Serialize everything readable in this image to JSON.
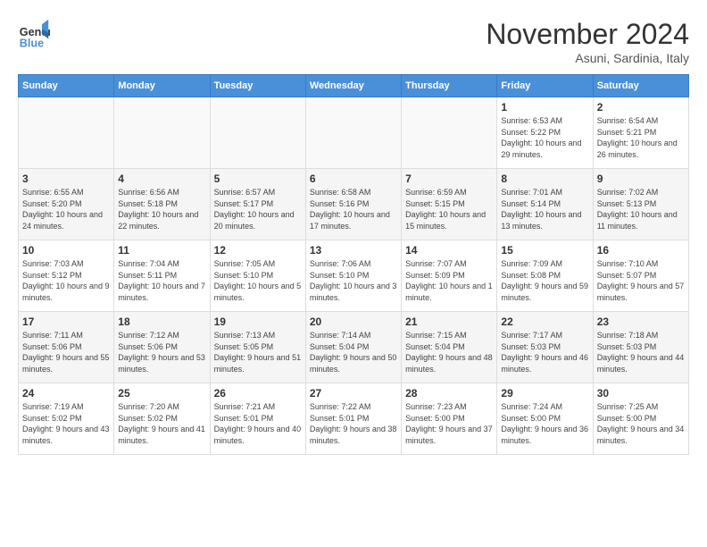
{
  "header": {
    "logo_text_general": "General",
    "logo_text_blue": "Blue",
    "month_title": "November 2024",
    "location": "Asuni, Sardinia, Italy"
  },
  "weekdays": [
    "Sunday",
    "Monday",
    "Tuesday",
    "Wednesday",
    "Thursday",
    "Friday",
    "Saturday"
  ],
  "weeks": [
    [
      {
        "day": "",
        "info": ""
      },
      {
        "day": "",
        "info": ""
      },
      {
        "day": "",
        "info": ""
      },
      {
        "day": "",
        "info": ""
      },
      {
        "day": "",
        "info": ""
      },
      {
        "day": "1",
        "info": "Sunrise: 6:53 AM\nSunset: 5:22 PM\nDaylight: 10 hours and 29 minutes."
      },
      {
        "day": "2",
        "info": "Sunrise: 6:54 AM\nSunset: 5:21 PM\nDaylight: 10 hours and 26 minutes."
      }
    ],
    [
      {
        "day": "3",
        "info": "Sunrise: 6:55 AM\nSunset: 5:20 PM\nDaylight: 10 hours and 24 minutes."
      },
      {
        "day": "4",
        "info": "Sunrise: 6:56 AM\nSunset: 5:18 PM\nDaylight: 10 hours and 22 minutes."
      },
      {
        "day": "5",
        "info": "Sunrise: 6:57 AM\nSunset: 5:17 PM\nDaylight: 10 hours and 20 minutes."
      },
      {
        "day": "6",
        "info": "Sunrise: 6:58 AM\nSunset: 5:16 PM\nDaylight: 10 hours and 17 minutes."
      },
      {
        "day": "7",
        "info": "Sunrise: 6:59 AM\nSunset: 5:15 PM\nDaylight: 10 hours and 15 minutes."
      },
      {
        "day": "8",
        "info": "Sunrise: 7:01 AM\nSunset: 5:14 PM\nDaylight: 10 hours and 13 minutes."
      },
      {
        "day": "9",
        "info": "Sunrise: 7:02 AM\nSunset: 5:13 PM\nDaylight: 10 hours and 11 minutes."
      }
    ],
    [
      {
        "day": "10",
        "info": "Sunrise: 7:03 AM\nSunset: 5:12 PM\nDaylight: 10 hours and 9 minutes."
      },
      {
        "day": "11",
        "info": "Sunrise: 7:04 AM\nSunset: 5:11 PM\nDaylight: 10 hours and 7 minutes."
      },
      {
        "day": "12",
        "info": "Sunrise: 7:05 AM\nSunset: 5:10 PM\nDaylight: 10 hours and 5 minutes."
      },
      {
        "day": "13",
        "info": "Sunrise: 7:06 AM\nSunset: 5:10 PM\nDaylight: 10 hours and 3 minutes."
      },
      {
        "day": "14",
        "info": "Sunrise: 7:07 AM\nSunset: 5:09 PM\nDaylight: 10 hours and 1 minute."
      },
      {
        "day": "15",
        "info": "Sunrise: 7:09 AM\nSunset: 5:08 PM\nDaylight: 9 hours and 59 minutes."
      },
      {
        "day": "16",
        "info": "Sunrise: 7:10 AM\nSunset: 5:07 PM\nDaylight: 9 hours and 57 minutes."
      }
    ],
    [
      {
        "day": "17",
        "info": "Sunrise: 7:11 AM\nSunset: 5:06 PM\nDaylight: 9 hours and 55 minutes."
      },
      {
        "day": "18",
        "info": "Sunrise: 7:12 AM\nSunset: 5:06 PM\nDaylight: 9 hours and 53 minutes."
      },
      {
        "day": "19",
        "info": "Sunrise: 7:13 AM\nSunset: 5:05 PM\nDaylight: 9 hours and 51 minutes."
      },
      {
        "day": "20",
        "info": "Sunrise: 7:14 AM\nSunset: 5:04 PM\nDaylight: 9 hours and 50 minutes."
      },
      {
        "day": "21",
        "info": "Sunrise: 7:15 AM\nSunset: 5:04 PM\nDaylight: 9 hours and 48 minutes."
      },
      {
        "day": "22",
        "info": "Sunrise: 7:17 AM\nSunset: 5:03 PM\nDaylight: 9 hours and 46 minutes."
      },
      {
        "day": "23",
        "info": "Sunrise: 7:18 AM\nSunset: 5:03 PM\nDaylight: 9 hours and 44 minutes."
      }
    ],
    [
      {
        "day": "24",
        "info": "Sunrise: 7:19 AM\nSunset: 5:02 PM\nDaylight: 9 hours and 43 minutes."
      },
      {
        "day": "25",
        "info": "Sunrise: 7:20 AM\nSunset: 5:02 PM\nDaylight: 9 hours and 41 minutes."
      },
      {
        "day": "26",
        "info": "Sunrise: 7:21 AM\nSunset: 5:01 PM\nDaylight: 9 hours and 40 minutes."
      },
      {
        "day": "27",
        "info": "Sunrise: 7:22 AM\nSunset: 5:01 PM\nDaylight: 9 hours and 38 minutes."
      },
      {
        "day": "28",
        "info": "Sunrise: 7:23 AM\nSunset: 5:00 PM\nDaylight: 9 hours and 37 minutes."
      },
      {
        "day": "29",
        "info": "Sunrise: 7:24 AM\nSunset: 5:00 PM\nDaylight: 9 hours and 36 minutes."
      },
      {
        "day": "30",
        "info": "Sunrise: 7:25 AM\nSunset: 5:00 PM\nDaylight: 9 hours and 34 minutes."
      }
    ]
  ]
}
